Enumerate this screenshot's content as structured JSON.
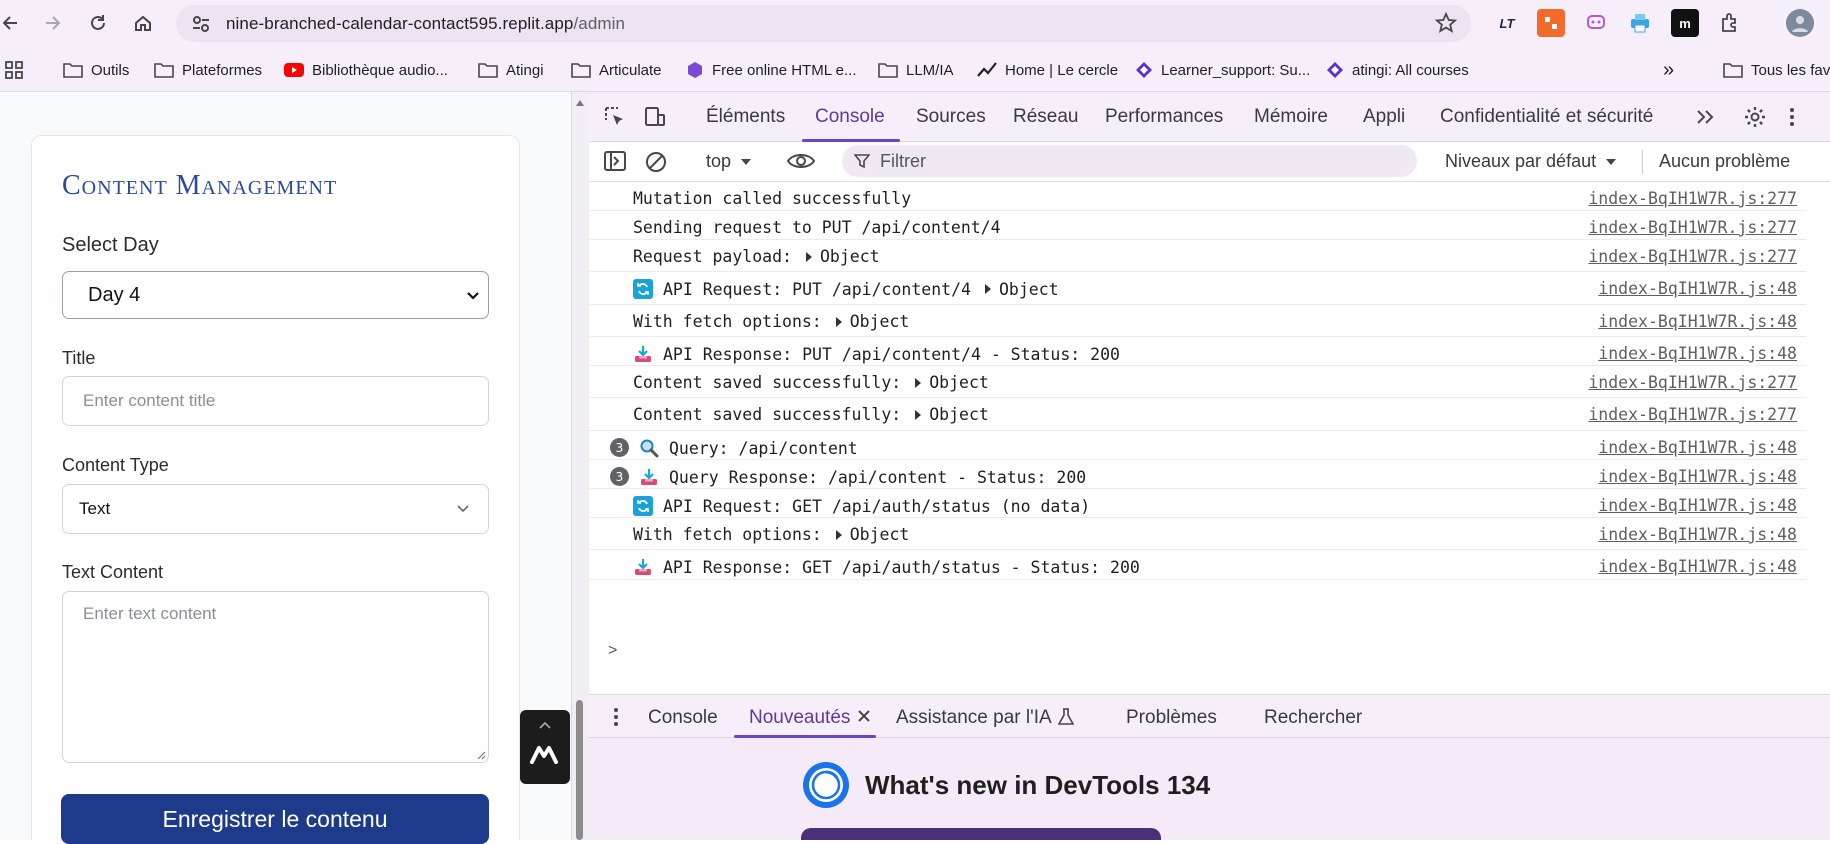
{
  "browser": {
    "url_host": "nine-branched-calendar-contact595.replit.app",
    "url_path": "/admin",
    "extensions": [
      "LT"
    ]
  },
  "bookmarks": [
    {
      "label": "Outils",
      "icon": "folder-icon"
    },
    {
      "label": "Plateformes",
      "icon": "folder-icon"
    },
    {
      "label": "Bibliothèque audio...",
      "icon": "youtube-icon"
    },
    {
      "label": "Atingi",
      "icon": "folder-icon"
    },
    {
      "label": "Articulate",
      "icon": "folder-icon"
    },
    {
      "label": "Free online HTML e...",
      "icon": "hexagon-icon"
    },
    {
      "label": "LLM/IA",
      "icon": "folder-icon"
    },
    {
      "label": "Home | Le cercle",
      "icon": "chart-line-icon"
    },
    {
      "label": "Learner_support: Su...",
      "icon": "diamond-icon"
    },
    {
      "label": "atingi: All courses",
      "icon": "diamond-icon"
    }
  ],
  "bookmarks_overflow": "»",
  "bookmarks_all": "Tous les fav",
  "page": {
    "card_title": "Content Management",
    "select_day_label": "Select Day",
    "select_day_value": "Day 4",
    "title_label": "Title",
    "title_placeholder": "Enter content title",
    "content_type_label": "Content Type",
    "content_type_value": "Text",
    "text_content_label": "Text Content",
    "text_content_placeholder": "Enter text content",
    "save_button": "Enregistrer le contenu"
  },
  "devtools": {
    "tabs": [
      "Éléments",
      "Console",
      "Sources",
      "Réseau",
      "Performances",
      "Mémoire",
      "Appli",
      "Confidentialité et sécurité"
    ],
    "active_tab": "Console",
    "context": "top",
    "filter_placeholder": "Filtrer",
    "levels": "Niveaux par défaut",
    "issues": "Aucun problème",
    "logs": [
      {
        "text": "Mutation called successfully",
        "obj": "",
        "src": "index-BqIH1W7R.js:277",
        "icon": "",
        "badge": ""
      },
      {
        "text": "Sending request to PUT /api/content/4",
        "obj": "",
        "src": "index-BqIH1W7R.js:277",
        "icon": "",
        "badge": ""
      },
      {
        "text": "Request payload:",
        "obj": "Object",
        "src": "index-BqIH1W7R.js:277",
        "icon": "",
        "badge": ""
      },
      {
        "text": "API Request: PUT /api/content/4",
        "obj": "Object",
        "src": "index-BqIH1W7R.js:48",
        "icon": "refresh",
        "badge": ""
      },
      {
        "text": "With fetch options:",
        "obj": "Object",
        "src": "index-BqIH1W7R.js:48",
        "icon": "",
        "badge": ""
      },
      {
        "text": "API Response: PUT /api/content/4 - Status: 200",
        "obj": "",
        "src": "index-BqIH1W7R.js:48",
        "icon": "inbox",
        "badge": ""
      },
      {
        "text": "Content saved successfully:",
        "obj": "Object",
        "src": "index-BqIH1W7R.js:277",
        "icon": "",
        "badge": ""
      },
      {
        "text": "Content saved successfully:",
        "obj": "Object",
        "src": "index-BqIH1W7R.js:277",
        "icon": "",
        "badge": ""
      },
      {
        "text": "Query: /api/content",
        "obj": "",
        "src": "index-BqIH1W7R.js:48",
        "icon": "magnifier",
        "badge": "3"
      },
      {
        "text": "Query Response: /api/content - Status: 200",
        "obj": "",
        "src": "index-BqIH1W7R.js:48",
        "icon": "inbox",
        "badge": "3"
      },
      {
        "text": "API Request: GET /api/auth/status (no data)",
        "obj": "",
        "src": "index-BqIH1W7R.js:48",
        "icon": "refresh",
        "badge": ""
      },
      {
        "text": "With fetch options:",
        "obj": "Object",
        "src": "index-BqIH1W7R.js:48",
        "icon": "",
        "badge": ""
      },
      {
        "text": "API Response: GET /api/auth/status - Status: 200",
        "obj": "",
        "src": "index-BqIH1W7R.js:48",
        "icon": "inbox",
        "badge": ""
      }
    ],
    "prompt": ">",
    "drawer_tabs": [
      "Console",
      "Nouveautés",
      "Assistance par l'IA",
      "Problèmes",
      "Rechercher"
    ],
    "drawer_active": "Nouveautés",
    "whats_new": "What's new in DevTools 134"
  },
  "colors": {
    "accent": "#6b46c1",
    "button": "#1e3a8a",
    "card_title": "#2d4a9a"
  }
}
